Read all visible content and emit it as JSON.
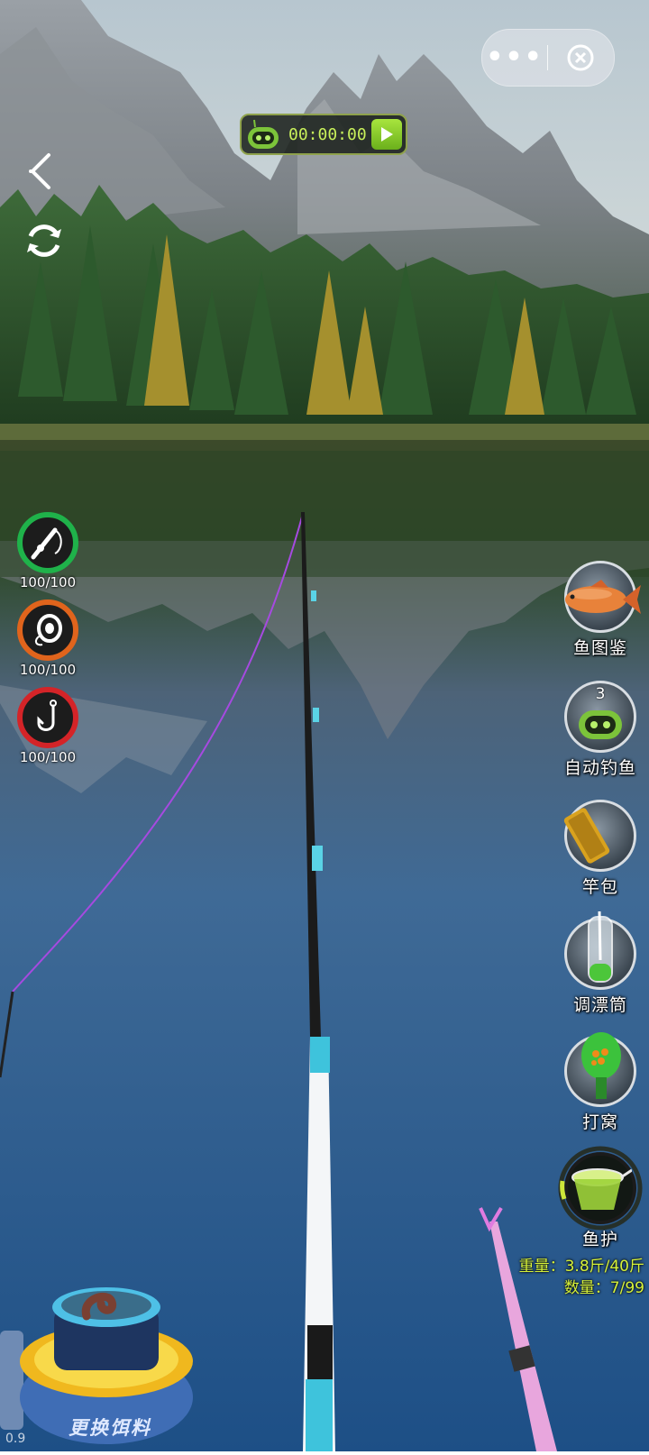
{
  "capsule": {
    "more": "•••"
  },
  "timer": {
    "time": "00:00:00"
  },
  "gauges": [
    {
      "label": "100/100",
      "fraction": 1.0,
      "color": "#1fb24a"
    },
    {
      "label": "100/100",
      "fraction": 1.0,
      "color": "#e0641c"
    },
    {
      "label": "100/100",
      "fraction": 1.0,
      "color": "#d42428"
    }
  ],
  "side_buttons": {
    "guide": "鱼图鉴",
    "auto": "自动钓鱼",
    "auto_count": "3",
    "rod_bag": "竿包",
    "float_tube": "调漂筒",
    "groundbait": "打窝",
    "keepnet": "鱼护"
  },
  "keepnet": {
    "weight": "重量：3.8斤/40斤",
    "count": "数量：7/99"
  },
  "bait": {
    "label": "更换饵料"
  },
  "version": "0.9",
  "colors": {
    "accent": "#c8f05a",
    "info": "#d7f23a",
    "line": "#a64ae0"
  }
}
